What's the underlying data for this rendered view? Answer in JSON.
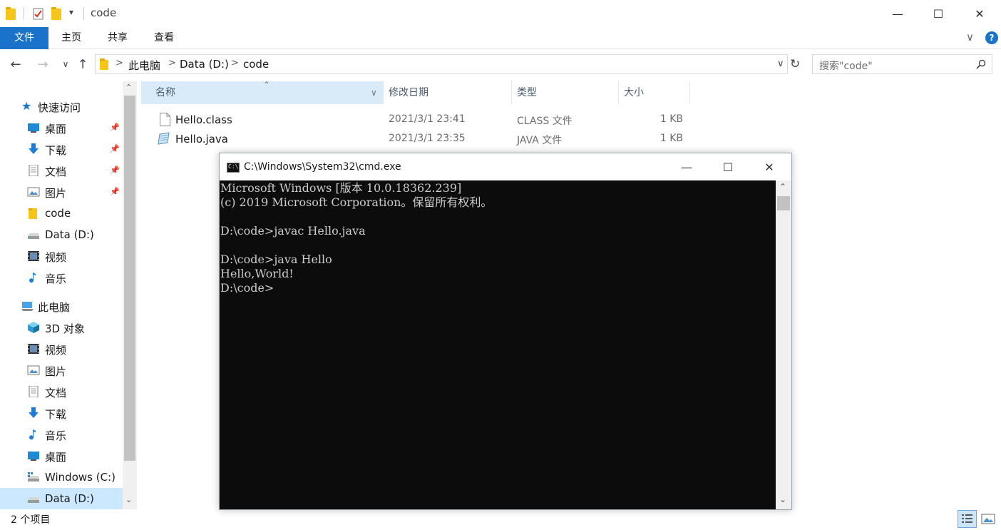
{
  "titlebar": {
    "title": "code",
    "qa_dropdown_glyph": "▾",
    "minimize": "—",
    "maximize": "☐",
    "close": "✕"
  },
  "ribbon": {
    "tabs": [
      {
        "label": "文件"
      },
      {
        "label": "主页"
      },
      {
        "label": "共享"
      },
      {
        "label": "查看"
      }
    ],
    "expand_glyph": "∨",
    "help_glyph": "?"
  },
  "address": {
    "crumbs": [
      "此电脑",
      "Data (D:)",
      "code"
    ],
    "search_placeholder": "搜索\"code\""
  },
  "navpane": {
    "quick_access": "快速访问",
    "quick_items": [
      {
        "label": "桌面",
        "icon": "desktop-icon",
        "pinned": true
      },
      {
        "label": "下载",
        "icon": "download-icon",
        "pinned": true
      },
      {
        "label": "文档",
        "icon": "document-icon",
        "pinned": true
      },
      {
        "label": "图片",
        "icon": "picture-icon",
        "pinned": true
      },
      {
        "label": "code",
        "icon": "folder-icon",
        "pinned": false
      },
      {
        "label": "Data (D:)",
        "icon": "drive-icon",
        "pinned": false
      },
      {
        "label": "视频",
        "icon": "video-icon",
        "pinned": false
      },
      {
        "label": "音乐",
        "icon": "music-icon",
        "pinned": false
      }
    ],
    "this_pc": "此电脑",
    "pc_items": [
      {
        "label": "3D 对象",
        "icon": "cube-icon"
      },
      {
        "label": "视频",
        "icon": "video-icon"
      },
      {
        "label": "图片",
        "icon": "picture-icon"
      },
      {
        "label": "文档",
        "icon": "document-icon"
      },
      {
        "label": "下载",
        "icon": "download-icon"
      },
      {
        "label": "音乐",
        "icon": "music-icon"
      },
      {
        "label": "桌面",
        "icon": "desktop-icon"
      },
      {
        "label": "Windows (C:)",
        "icon": "windows-drive-icon"
      },
      {
        "label": "Data (D:)",
        "icon": "drive-icon"
      }
    ]
  },
  "filelist": {
    "columns": {
      "name": "名称",
      "modified": "修改日期",
      "type": "类型",
      "size": "大小"
    },
    "files": [
      {
        "name": "Hello.class",
        "modified": "2021/3/1 23:41",
        "type": "CLASS 文件",
        "size": "1 KB"
      },
      {
        "name": "Hello.java",
        "modified": "2021/3/1 23:35",
        "type": "JAVA 文件",
        "size": "1 KB"
      }
    ]
  },
  "status": {
    "count": "2 个项目"
  },
  "cmd": {
    "title": "C:\\Windows\\System32\\cmd.exe",
    "lines": [
      "Microsoft Windows [版本 10.0.18362.239]",
      "(c) 2019 Microsoft Corporation。保留所有权利。",
      "",
      "D:\\code>javac Hello.java",
      "",
      "D:\\code>java Hello",
      "Hello,World!",
      "D:\\code>"
    ]
  },
  "colors": {
    "accent": "#1a73c8",
    "selection": "#cce8ff",
    "console_bg": "#0c0c0c",
    "console_fg": "#cccccc"
  }
}
